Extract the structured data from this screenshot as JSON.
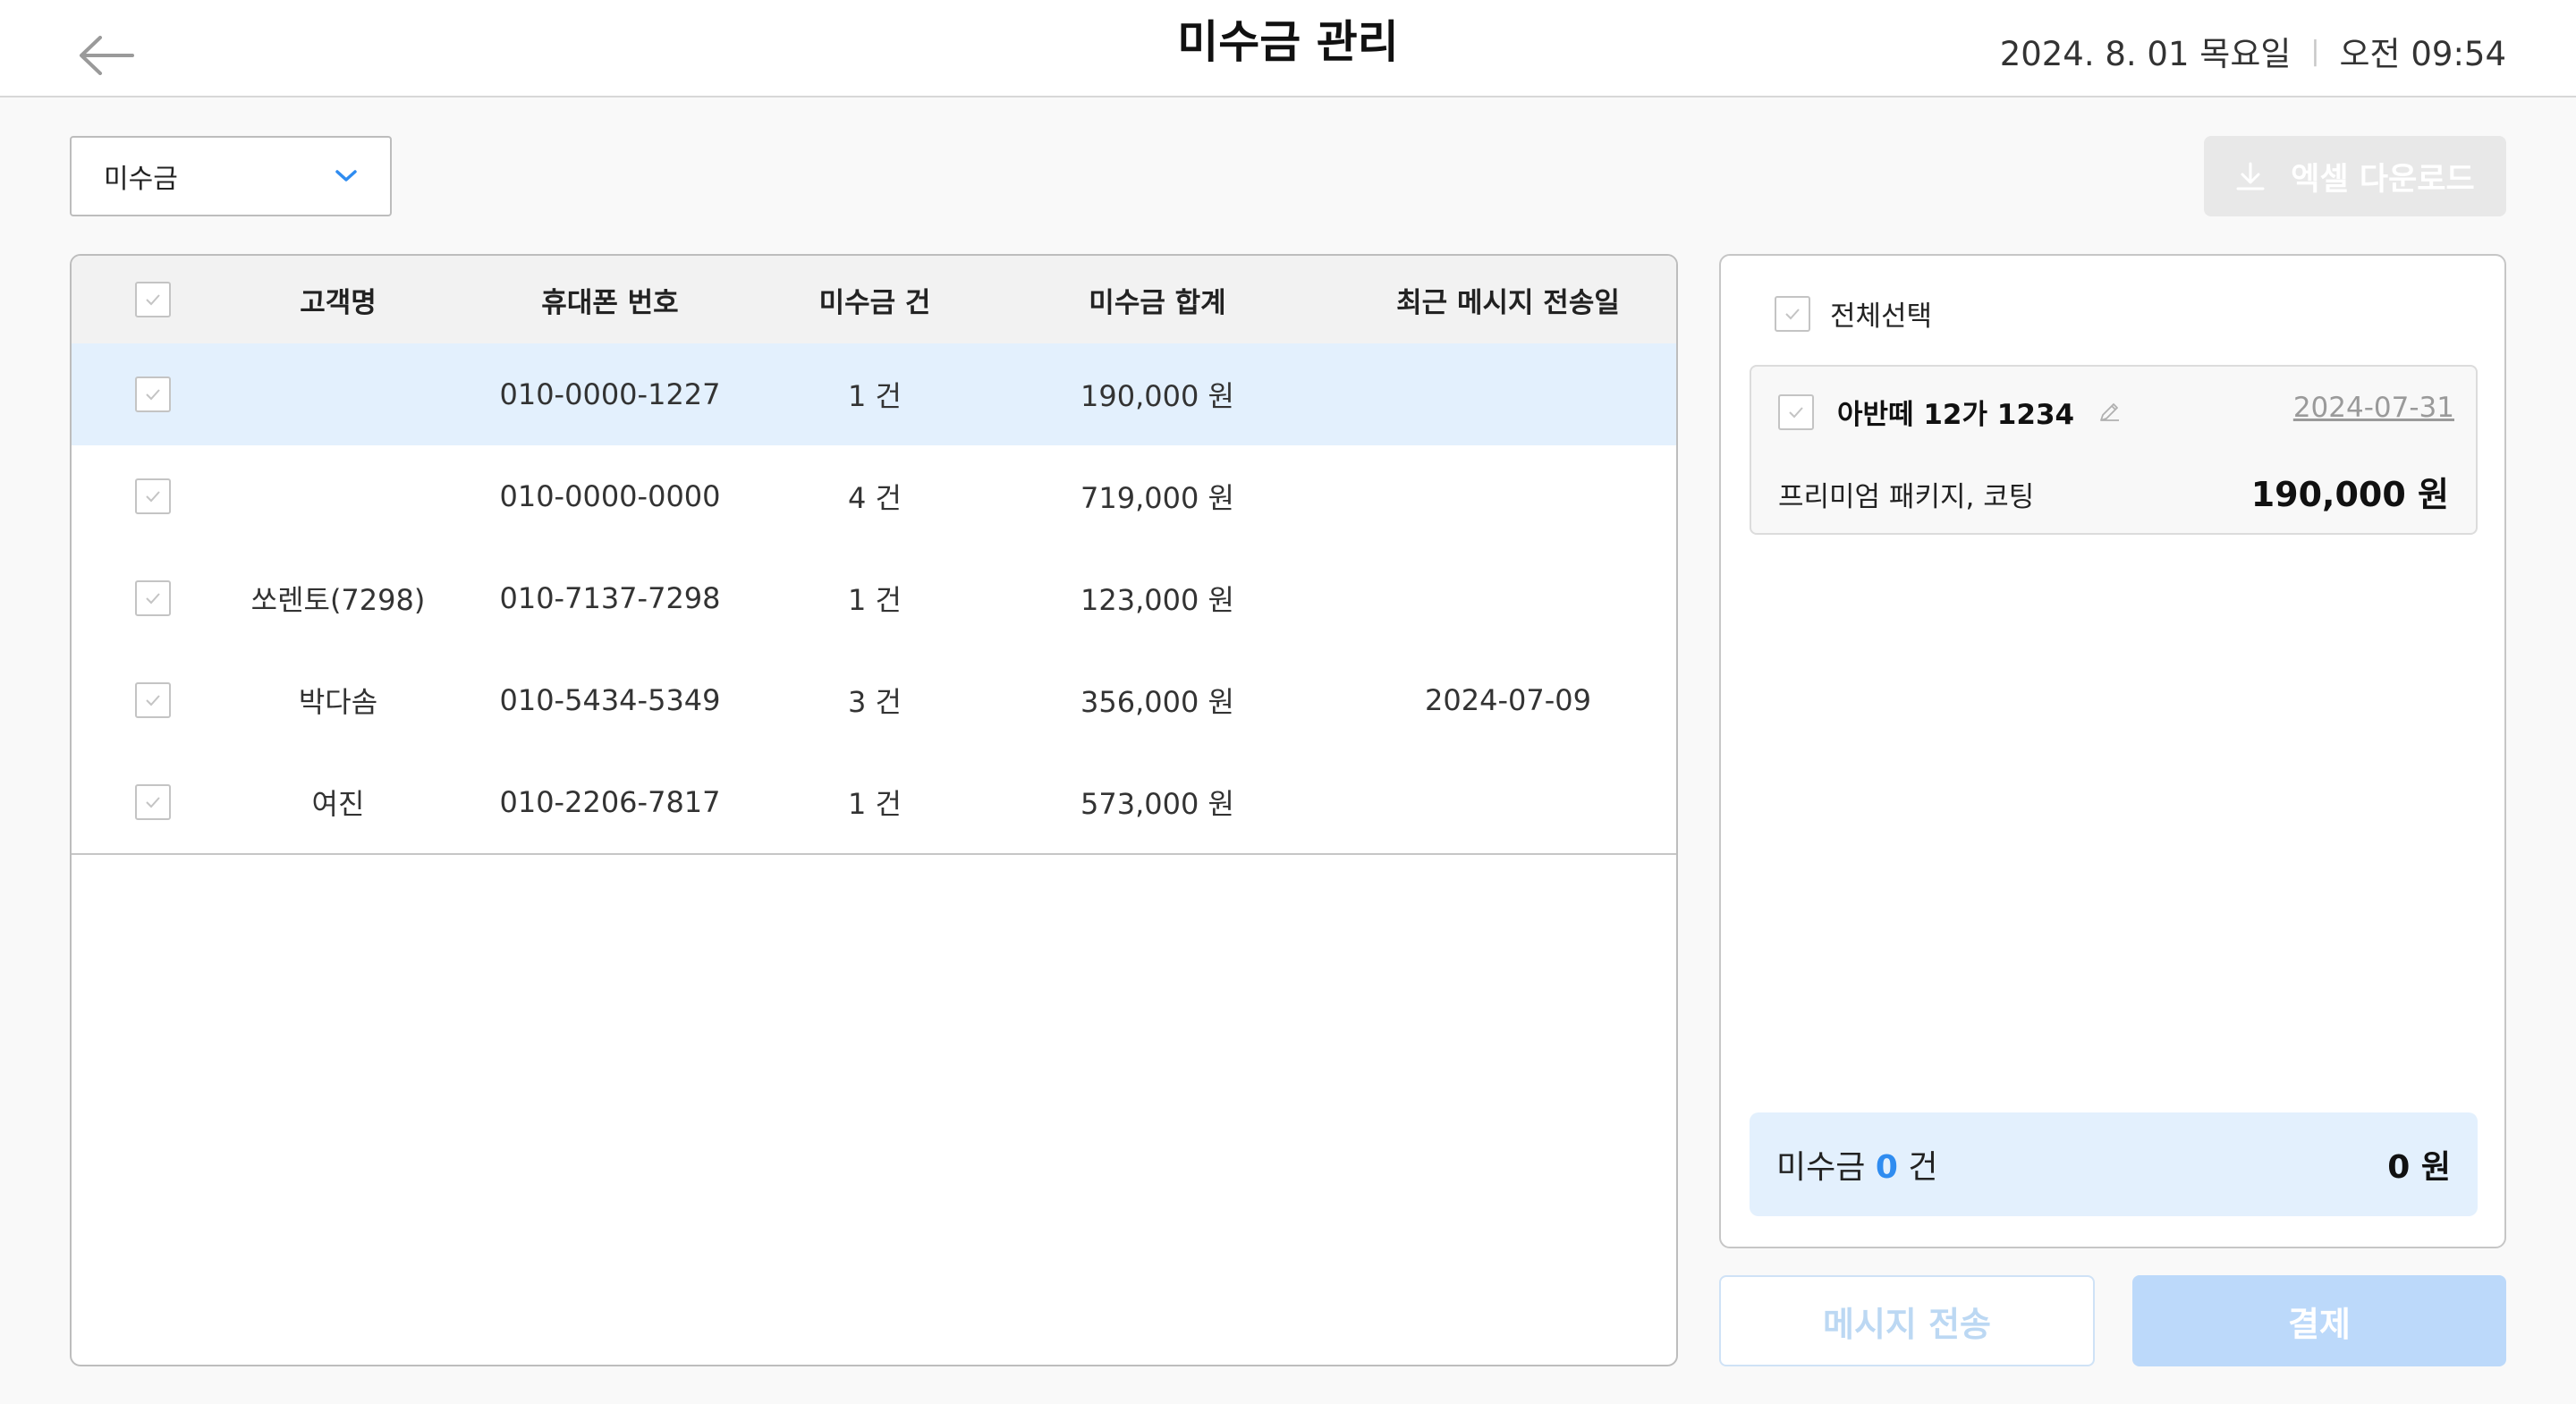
{
  "header": {
    "title": "미수금 관리",
    "date": "2024. 8. 01 목요일",
    "separator": "|",
    "time": "오전 09:54"
  },
  "filter": {
    "selected": "미수금"
  },
  "toolbar": {
    "excel_label": "엑셀 다운로드"
  },
  "table": {
    "columns": [
      "고객명",
      "휴대폰 번호",
      "미수금 건",
      "미수금 합계",
      "최근 메시지 전송일"
    ],
    "rows": [
      {
        "name": "",
        "phone": "010-0000-1227",
        "count": "1 건",
        "total": "190,000 원",
        "last_msg": "",
        "selected": true
      },
      {
        "name": "",
        "phone": "010-0000-0000",
        "count": "4 건",
        "total": "719,000 원",
        "last_msg": "",
        "selected": false
      },
      {
        "name": "쏘렌토(7298)",
        "phone": "010-7137-7298",
        "count": "1 건",
        "total": "123,000 원",
        "last_msg": "",
        "selected": false
      },
      {
        "name": "박다솜",
        "phone": "010-5434-5349",
        "count": "3 건",
        "total": "356,000 원",
        "last_msg": "2024-07-09",
        "selected": false
      },
      {
        "name": "여진",
        "phone": "010-2206-7817",
        "count": "1 건",
        "total": "573,000 원",
        "last_msg": "",
        "selected": false
      }
    ]
  },
  "detail": {
    "select_all_label": "전체선택",
    "items": [
      {
        "vehicle": "아반떼 12가 1234",
        "date": "2024-07-31",
        "description": "프리미엄 패키지, 코팅",
        "amount": "190,000 원"
      }
    ],
    "summary": {
      "label": "미수금",
      "count": "0",
      "count_unit": "건",
      "total": "0 원"
    }
  },
  "actions": {
    "message_label": "메시지 전송",
    "pay_label": "결제"
  },
  "colors": {
    "accent": "#2f8cf0",
    "selected_row": "#e3f0fd",
    "pay_disabled": "#bcd9fa"
  }
}
